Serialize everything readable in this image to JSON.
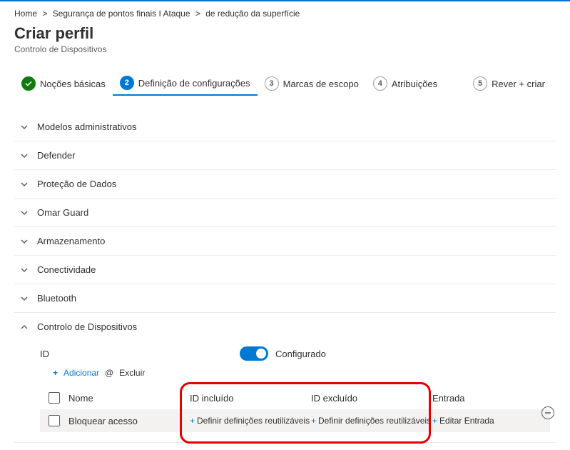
{
  "breadcrumb": {
    "item1": "Home",
    "sep": "&gt;",
    "item2": "Segurança de pontos finais I Ataque",
    "item3": "de redução da superfície"
  },
  "page": {
    "title": "Criar perfil",
    "subtitle": "Controlo de Dispositivos"
  },
  "steps": {
    "s1": {
      "label": "Noções básicas"
    },
    "s2": {
      "label": "Definição de configurações",
      "num": "2"
    },
    "s3": {
      "label": "Marcas de escopo",
      "num": "3"
    },
    "s4": {
      "label": "Atribuições",
      "num": "4"
    },
    "s5": {
      "label": "Rever + criar",
      "num": "5"
    }
  },
  "sections": {
    "a1": "Modelos administrativos",
    "a2": "Defender",
    "a3": "Proteção de Dados",
    "a4": "Omar Guard",
    "a5": "Armazenamento",
    "a6": "Conectividade",
    "a7": "Bluetooth",
    "a8": "Controlo de Dispositivos"
  },
  "device": {
    "id_label": "ID",
    "toggle_label": "Configurado",
    "add_label": "Adicionar",
    "at_label": "@",
    "del_label": "Excluir"
  },
  "table": {
    "headers": {
      "name": "Nome",
      "included": "ID incluído",
      "excluded": "ID excluído",
      "entry": "Entrada"
    },
    "row1": {
      "name": "Bloquear acesso",
      "included": "Definir definições reutilizáveis",
      "excluded": "Definir definições reutilizáveis",
      "entry": "Editar Entrada"
    }
  }
}
